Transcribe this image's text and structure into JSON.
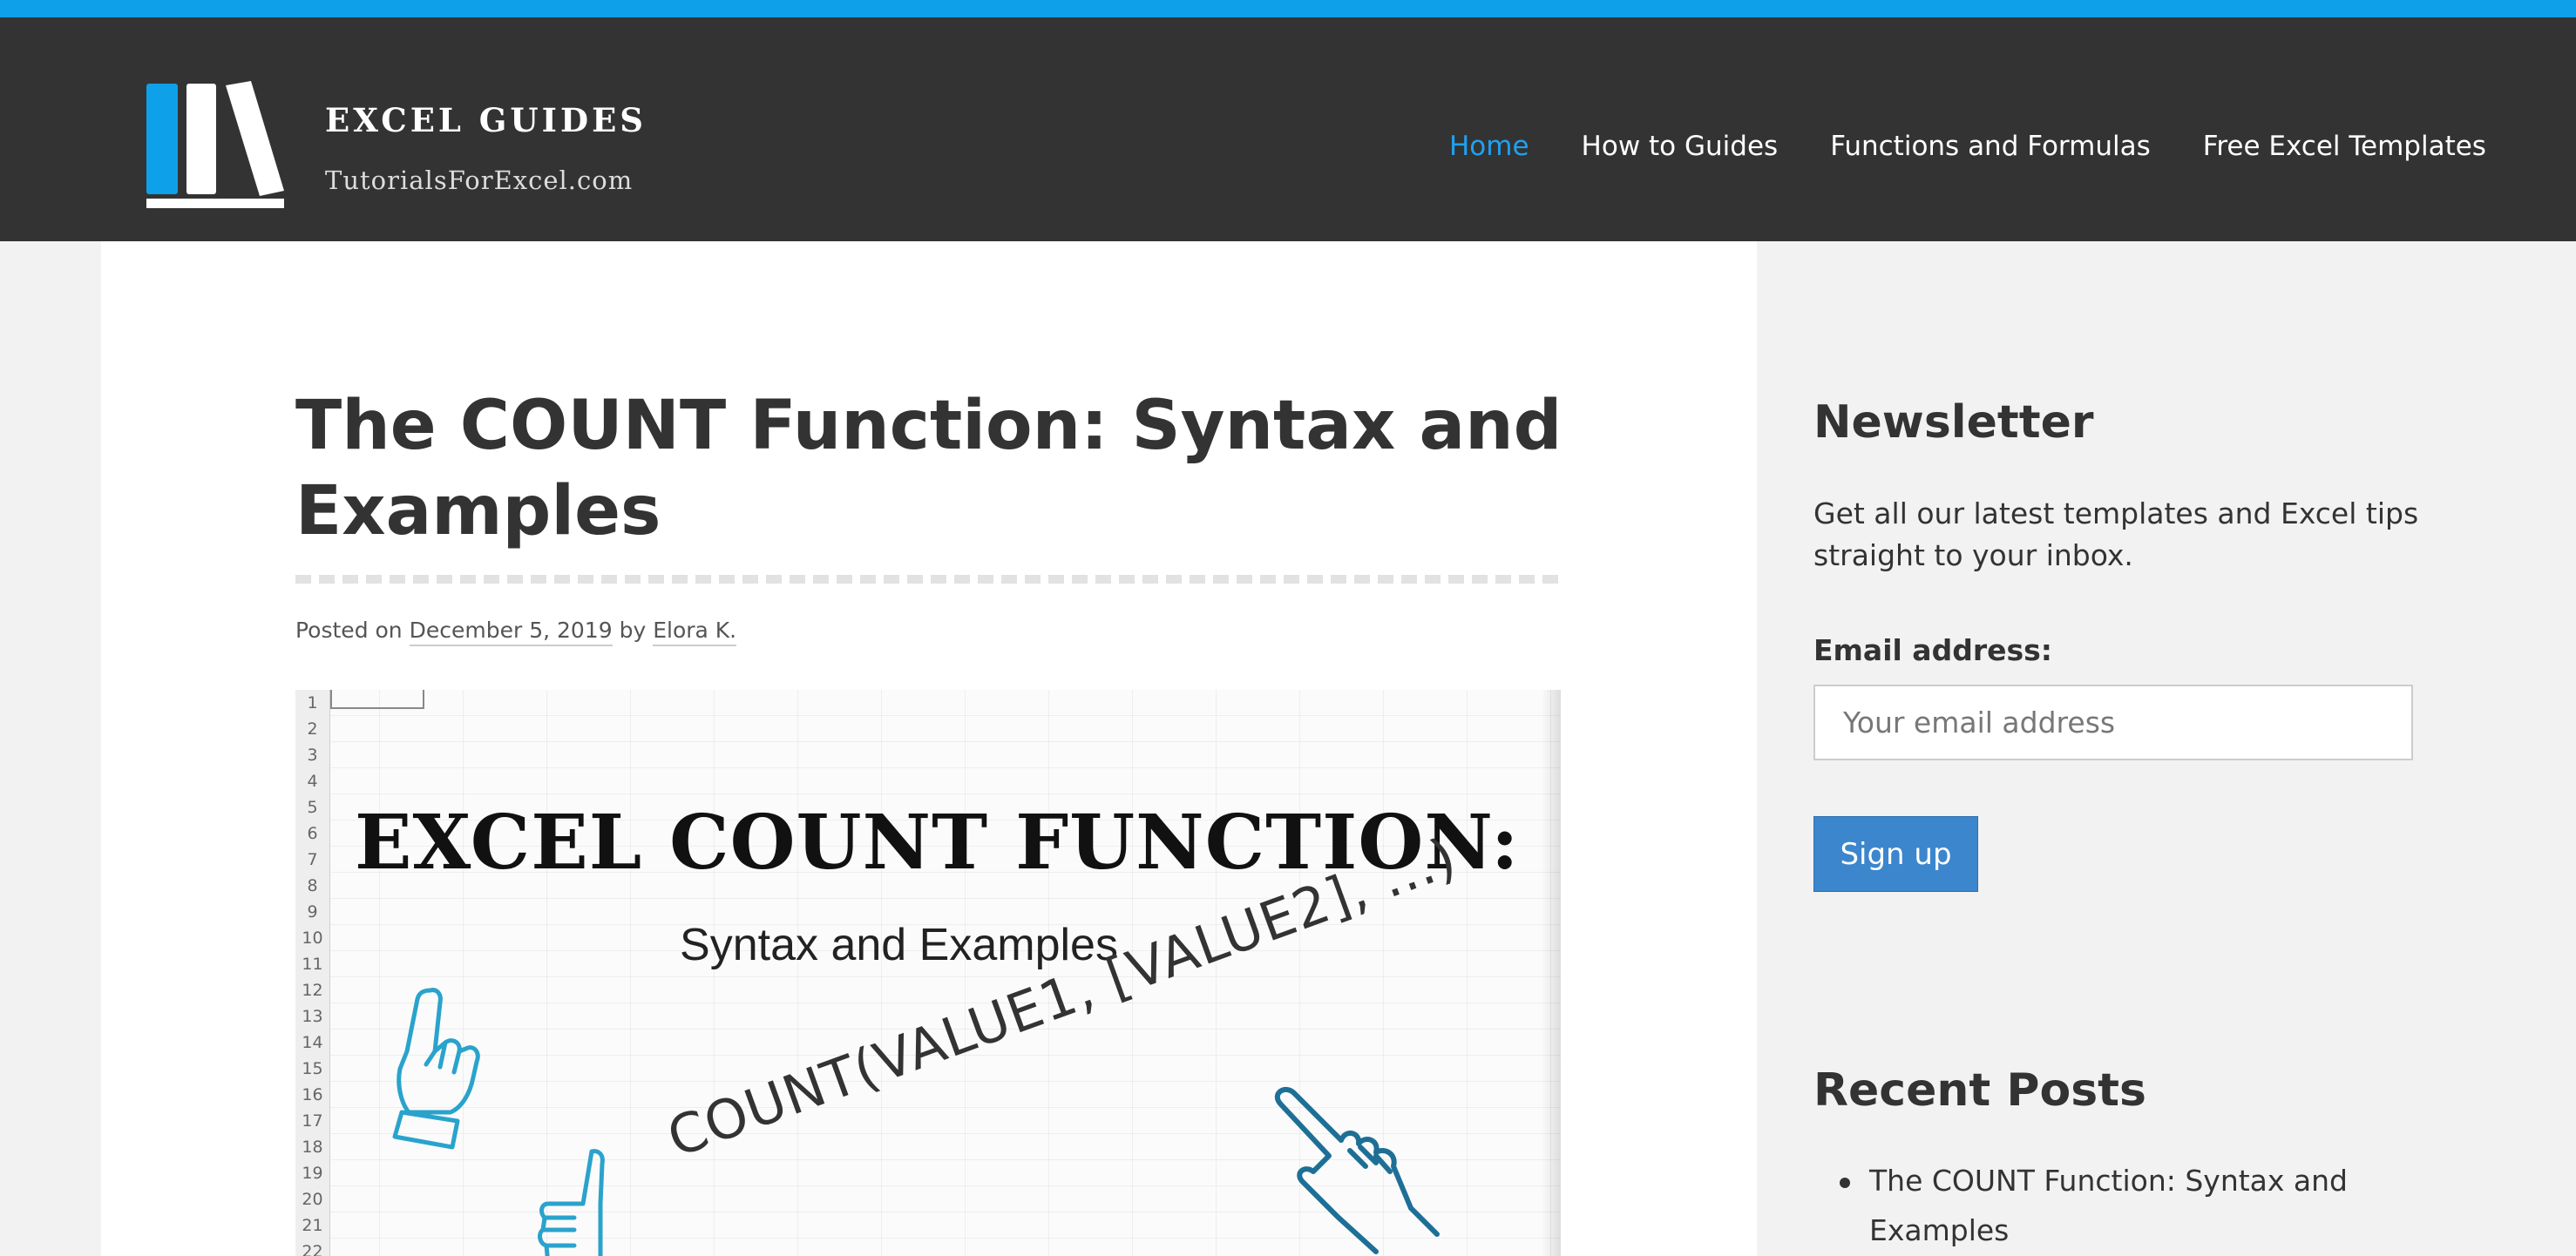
{
  "site": {
    "title": "EXCEL GUIDES",
    "subtitle": "TutorialsForExcel.com",
    "logo_icon": "books-logo-icon",
    "colors": {
      "accent_stripe": "#0ea0e8",
      "header_bg": "#333333",
      "nav_active": "#1ea1f2",
      "button": "#3b86cc"
    }
  },
  "nav": {
    "items": [
      {
        "label": "Home",
        "active": true
      },
      {
        "label": "How to Guides",
        "active": false
      },
      {
        "label": "Functions and Formulas",
        "active": false
      },
      {
        "label": "Free Excel Templates",
        "active": false
      }
    ]
  },
  "post": {
    "title": "The COUNT Function: Syntax and Examples",
    "posted_on_label": "Posted on",
    "date": "December 5, 2019",
    "by_label": "by",
    "author": "Elora K.",
    "image": {
      "heading": "EXCEL COUNT FUNCTION:",
      "subheading": "Syntax and Examples",
      "formula": "COUNT(VALUE1, [VALUE2], ...)",
      "row_numbers": [
        "1",
        "2",
        "3",
        "4",
        "5",
        "6",
        "7",
        "8",
        "9",
        "10",
        "11",
        "12",
        "13",
        "14",
        "15",
        "16",
        "17",
        "18",
        "19",
        "20",
        "21",
        "22"
      ]
    }
  },
  "sidebar": {
    "newsletter": {
      "heading": "Newsletter",
      "text": "Get all our latest templates and Excel tips straight to your inbox.",
      "email_label": "Email address:",
      "email_placeholder": "Your email address",
      "signup_label": "Sign up"
    },
    "recent_posts": {
      "heading": "Recent Posts",
      "items": [
        "The COUNT Function: Syntax and Examples"
      ]
    }
  }
}
